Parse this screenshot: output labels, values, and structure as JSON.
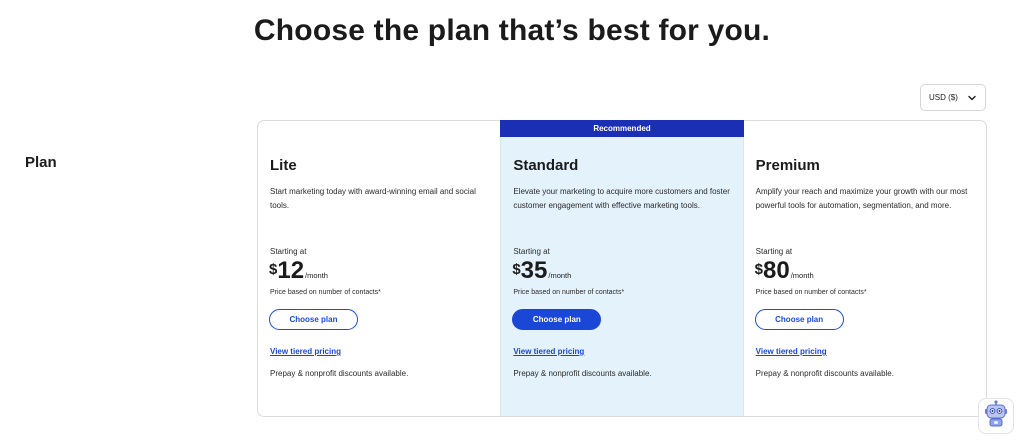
{
  "headline": "Choose the plan that’s best for you.",
  "currency": {
    "label": "USD ($)",
    "icon": "chevron-down-icon"
  },
  "row_label": "Plan",
  "recommended_label": "Recommended",
  "plans": [
    {
      "name": "Lite",
      "description": "Start marketing today with award-winning email and social tools.",
      "starting_at": "Starting at",
      "currency_symbol": "$",
      "price": "12",
      "period": "/month",
      "price_basis": "Price based on number of contacts*",
      "cta": "Choose plan",
      "tiered_link": "View tiered pricing",
      "discount_note": "Prepay & nonprofit discounts available."
    },
    {
      "name": "Standard",
      "description": "Elevate your marketing to acquire more customers and foster customer engagement with effective marketing tools.",
      "starting_at": "Starting at",
      "currency_symbol": "$",
      "price": "35",
      "period": "/month",
      "price_basis": "Price based on number of contacts*",
      "cta": "Choose plan",
      "tiered_link": "View tiered pricing",
      "discount_note": "Prepay & nonprofit discounts available."
    },
    {
      "name": "Premium",
      "description": "Amplify your reach and maximize your growth with our most powerful tools for automation, segmentation, and more.",
      "starting_at": "Starting at",
      "currency_symbol": "$",
      "price": "80",
      "period": "/month",
      "price_basis": "Price based on number of contacts*",
      "cta": "Choose plan",
      "tiered_link": "View tiered pricing",
      "discount_note": "Prepay & nonprofit discounts available."
    }
  ],
  "colors": {
    "recommended_banner": "#1b2fb4",
    "recommended_column_bg": "#e3f2fb",
    "primary_blue": "#1b47d6"
  },
  "assistant_widget": {
    "icon": "robot-assistant-icon"
  }
}
